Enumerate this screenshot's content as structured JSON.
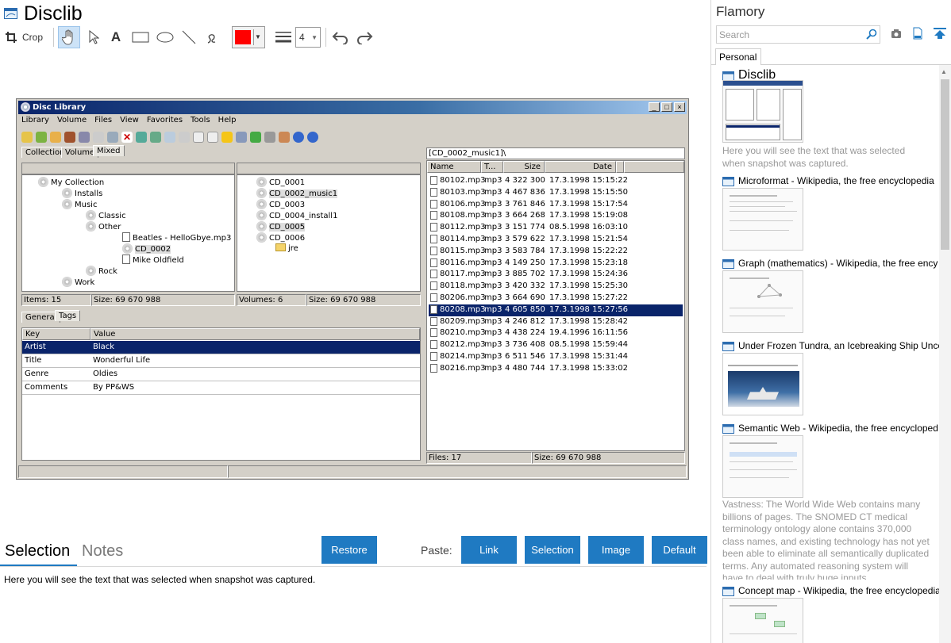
{
  "document": {
    "title": "Disclib",
    "toolbar": {
      "crop_label": "Crop",
      "line_width": "4",
      "color": "#ff0000"
    }
  },
  "screenshot": {
    "window_title": "Disc Library",
    "menu": [
      "Library",
      "Volume",
      "Files",
      "View",
      "Favorites",
      "Tools",
      "Help"
    ],
    "tabs": [
      "Collection",
      "Volume",
      "Mixed"
    ],
    "tree": [
      {
        "label": "My Collection",
        "level": 0
      },
      {
        "label": "Installs",
        "level": 1
      },
      {
        "label": "Music",
        "level": 1
      },
      {
        "label": "Classic",
        "level": 2
      },
      {
        "label": "Other",
        "level": 2
      },
      {
        "label": "Beatles - HelloGbye.mp3",
        "level": 3
      },
      {
        "label": "CD_0002",
        "level": 3
      },
      {
        "label": "Mike Oldfield",
        "level": 3
      },
      {
        "label": "Rock",
        "level": 2
      },
      {
        "label": "Work",
        "level": 1
      }
    ],
    "volumes": [
      {
        "label": "CD_0001",
        "level": 0
      },
      {
        "label": "CD_0002_music1",
        "level": 0
      },
      {
        "label": "CD_0003",
        "level": 0
      },
      {
        "label": "CD_0004_install1",
        "level": 0
      },
      {
        "label": "CD_0005",
        "level": 0
      },
      {
        "label": "CD_0006",
        "level": 0
      },
      {
        "label": "jre",
        "level": 1
      }
    ],
    "left_status": {
      "items": "Items: 15",
      "size": "Size: 69 670 988"
    },
    "mid_status": {
      "volumes": "Volumes: 6",
      "size": "Size: 69 670 988"
    },
    "path": "[CD_0002_music1]\\",
    "file_columns": [
      "Name",
      "T...",
      "Size",
      "Date"
    ],
    "files": [
      {
        "name": "80102.mp3",
        "type": "mp3",
        "size": "4 322 300",
        "date": "17.3.1998 15:15:22"
      },
      {
        "name": "80103.mp3",
        "type": "mp3",
        "size": "4 467 836",
        "date": "17.3.1998 15:15:50"
      },
      {
        "name": "80106.mp3",
        "type": "mp3",
        "size": "3 761 846",
        "date": "17.3.1998 15:17:54"
      },
      {
        "name": "80108.mp3",
        "type": "mp3",
        "size": "3 664 268",
        "date": "17.3.1998 15:19:08"
      },
      {
        "name": "80112.mp3",
        "type": "mp3",
        "size": "3 151 774",
        "date": "08.5.1998 16:03:10"
      },
      {
        "name": "80114.mp3",
        "type": "mp3",
        "size": "3 579 622",
        "date": "17.3.1998 15:21:54"
      },
      {
        "name": "80115.mp3",
        "type": "mp3",
        "size": "3 583 784",
        "date": "17.3.1998 15:22:22"
      },
      {
        "name": "80116.mp3",
        "type": "mp3",
        "size": "4 149 250",
        "date": "17.3.1998 15:23:18"
      },
      {
        "name": "80117.mp3",
        "type": "mp3",
        "size": "3 885 702",
        "date": "17.3.1998 15:24:36"
      },
      {
        "name": "80118.mp3",
        "type": "mp3",
        "size": "3 420 332",
        "date": "17.3.1998 15:25:30"
      },
      {
        "name": "80206.mp3",
        "type": "mp3",
        "size": "3 664 690",
        "date": "17.3.1998 15:27:22"
      },
      {
        "name": "80208.mp3",
        "type": "mp3",
        "size": "4 605 850",
        "date": "17.3.1998 15:27:56"
      },
      {
        "name": "80209.mp3",
        "type": "mp3",
        "size": "4 246 812",
        "date": "17.3.1998 15:28:42"
      },
      {
        "name": "80210.mp3",
        "type": "mp3",
        "size": "4 438 224",
        "date": "19.4.1996 16:11:56"
      },
      {
        "name": "80212.mp3",
        "type": "mp3",
        "size": "3 736 408",
        "date": "08.5.1998 15:59:44"
      },
      {
        "name": "80214.mp3",
        "type": "mp3",
        "size": "6 511 546",
        "date": "17.3.1998 15:31:44"
      },
      {
        "name": "80216.mp3",
        "type": "mp3",
        "size": "4 480 744",
        "date": "17.3.1998 15:33:02"
      }
    ],
    "right_status": {
      "files": "Files: 17",
      "size": "Size: 69 670 988"
    },
    "detail_tabs": [
      "General",
      "Tags"
    ],
    "tag_columns": [
      "Key",
      "Value"
    ],
    "tags": [
      {
        "key": "Artist",
        "value": "Black"
      },
      {
        "key": "Title",
        "value": "Wonderful Life"
      },
      {
        "key": "Genre",
        "value": "Oldies"
      },
      {
        "key": "Comments",
        "value": "By PP&WS"
      }
    ]
  },
  "bottom": {
    "tab_selection": "Selection",
    "tab_notes": "Notes",
    "restore_label": "Restore",
    "paste_label": "Paste:",
    "link_label": "Link",
    "selection_label": "Selection",
    "image_label": "Image",
    "default_label": "Default",
    "selection_text": "Here you will see the text that was selected when snapshot was captured."
  },
  "sidebar": {
    "app_name": "Flamory",
    "search_placeholder": "Search",
    "tab_personal": "Personal",
    "entries": [
      {
        "title": "Disclib",
        "desc": "Here you will see the text that was selected when snapshot was captured."
      },
      {
        "title": "Microformat - Wikipedia, the free encyclopedia"
      },
      {
        "title": "Graph (mathematics) - Wikipedia, the free ency"
      },
      {
        "title": "Under Frozen Tundra, an Icebreaking Ship Unco"
      },
      {
        "title": "Semantic Web - Wikipedia, the free encycloped",
        "desc": "Vastness: The World Wide Web contains many billions of pages. The SNOMED CT medical terminology ontology alone contains 370,000 class names, and existing technology has not yet been able to eliminate all semantically duplicated terms. Any automated reasoning system will have to deal with truly huge inputs."
      },
      {
        "title": "Concept map - Wikipedia, the free encyclopedia"
      }
    ]
  },
  "colors": {
    "accent": "#1f7ac2",
    "selection": "#0a246a",
    "win_gray": "#d4d0c8"
  }
}
